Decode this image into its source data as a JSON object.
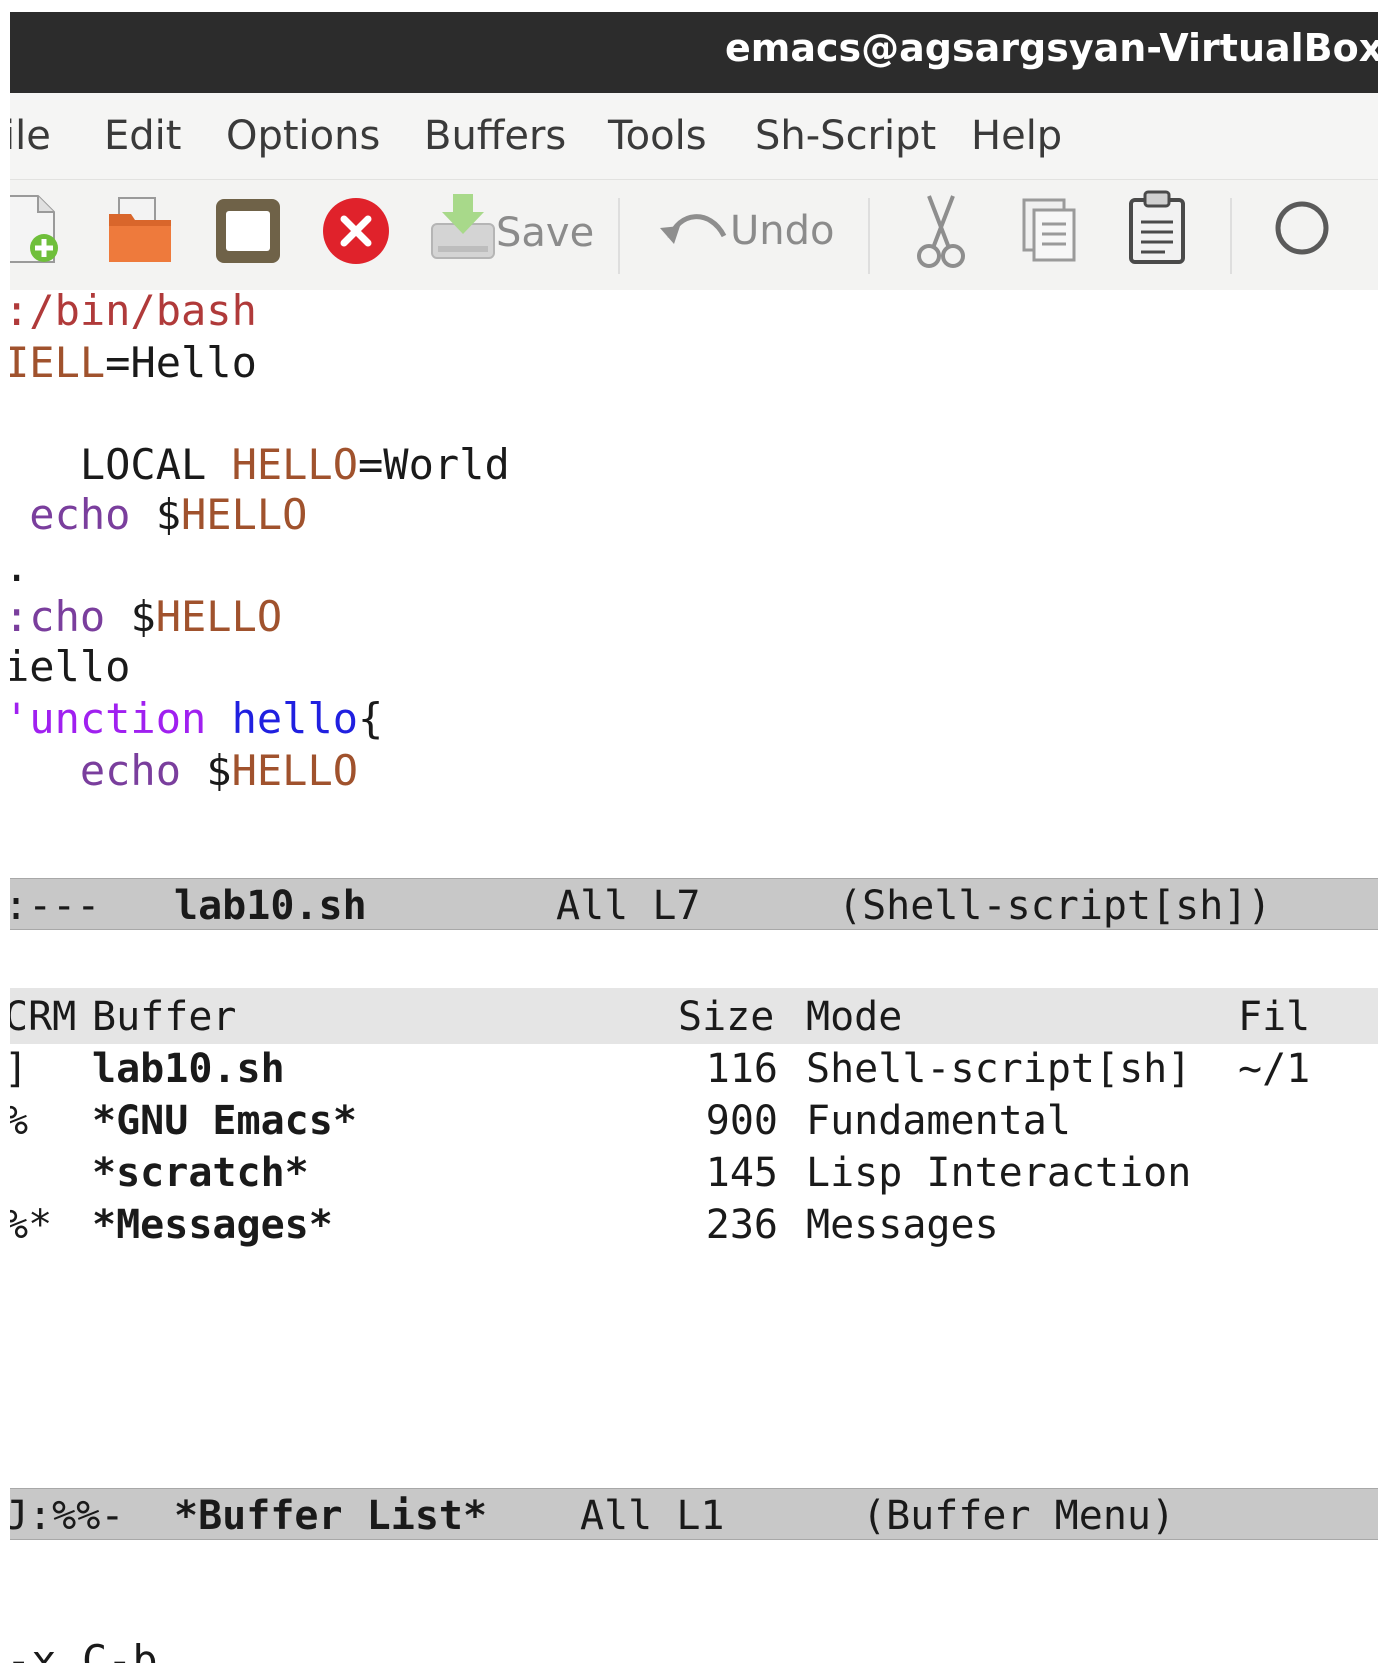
{
  "window": {
    "title": "emacs@agsargsyan-VirtualBox"
  },
  "menubar": {
    "items": [
      "ile",
      "Edit",
      "Options",
      "Buffers",
      "Tools",
      "Sh-Script",
      "Help"
    ]
  },
  "toolbar": {
    "save_label": "Save",
    "undo_label": "Undo",
    "icons": [
      "new-file-icon",
      "open-folder-icon",
      "window-icon",
      "close-icon",
      "save-icon",
      "undo-icon",
      "cut-icon",
      "copy-icon",
      "paste-icon",
      "search-icon"
    ]
  },
  "editor": {
    "lines": [
      {
        "parts": [
          {
            "text": ":/bin/bash",
            "color": "#b03a3a"
          }
        ]
      },
      {
        "parts": [
          {
            "text": "IELL",
            "color": "#a0522d"
          },
          {
            "text": "=Hello",
            "color": "#1a1a1a"
          }
        ]
      },
      {
        "parts": []
      },
      {
        "parts": [
          {
            "text": "   LOCAL ",
            "color": "#1a1a1a"
          },
          {
            "text": "HELLO",
            "color": "#a0522d"
          },
          {
            "text": "=World",
            "color": "#1a1a1a"
          }
        ]
      },
      {
        "parts": [
          {
            "text": " echo",
            "color": "#7a3e9d"
          },
          {
            "text": " $",
            "color": "#1a1a1a"
          },
          {
            "text": "HELLO",
            "color": "#a0522d"
          }
        ]
      },
      {
        "parts": [
          {
            "text": ".",
            "color": "#1a1a1a"
          }
        ]
      },
      {
        "parts": [
          {
            "text": ":cho",
            "color": "#7a3e9d"
          },
          {
            "text": " $",
            "color": "#1a1a1a"
          },
          {
            "text": "HELLO",
            "color": "#a0522d"
          }
        ]
      },
      {
        "parts": [
          {
            "text": "iello",
            "color": "#1a1a1a"
          }
        ]
      },
      {
        "parts": [
          {
            "text": "'unction",
            "color": "#a020f0"
          },
          {
            "text": " ",
            "color": "#1a1a1a"
          },
          {
            "text": "hello",
            "color": "#2020e0"
          },
          {
            "text": "{",
            "color": "#1a1a1a"
          }
        ]
      },
      {
        "parts": [
          {
            "text": "   echo",
            "color": "#7a3e9d"
          },
          {
            "text": " $",
            "color": "#1a1a1a"
          },
          {
            "text": "HELLO",
            "color": "#a0522d"
          }
        ]
      }
    ]
  },
  "modeline_top": {
    "status": ":---",
    "buffer": "lab10.sh",
    "position": "All L7",
    "mode": "(Shell-script[sh])"
  },
  "buffer_list": {
    "headers": {
      "crm": "CRM",
      "buffer": "Buffer",
      "size": "Size",
      "mode": "Mode",
      "file": "Fil"
    },
    "rows": [
      {
        "crm": "]",
        "buffer": "lab10.sh",
        "size": "116",
        "mode": "Shell-script[sh]",
        "file": "~/1"
      },
      {
        "crm": "%",
        "buffer": "*GNU Emacs*",
        "size": "900",
        "mode": "Fundamental",
        "file": ""
      },
      {
        "crm": "",
        "buffer": "*scratch*",
        "size": "145",
        "mode": "Lisp Interaction",
        "file": ""
      },
      {
        "crm": "%*",
        "buffer": "*Messages*",
        "size": "236",
        "mode": "Messages",
        "file": ""
      }
    ]
  },
  "modeline_bottom": {
    "status": "J:%%-",
    "buffer": "*Buffer List*",
    "position": "All L1",
    "mode": "(Buffer Menu)"
  },
  "minibuffer": {
    "text": "-x C-b"
  }
}
